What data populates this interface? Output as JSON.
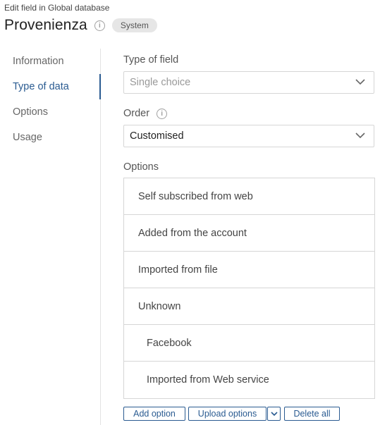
{
  "header": {
    "subtitle": "Edit field in Global database",
    "title": "Provenienza",
    "badge": "System"
  },
  "sidebar": {
    "items": [
      {
        "label": "Information"
      },
      {
        "label": "Type of data"
      },
      {
        "label": "Options"
      },
      {
        "label": "Usage"
      }
    ],
    "active": "Type of data"
  },
  "form": {
    "type_of_field": {
      "label": "Type of field",
      "value": "Single choice"
    },
    "order": {
      "label": "Order",
      "value": "Customised"
    },
    "options_label": "Options",
    "options": [
      {
        "label": "Self subscribed from web"
      },
      {
        "label": "Added from the account"
      },
      {
        "label": "Imported from file"
      },
      {
        "label": "Unknown"
      },
      {
        "label": "Facebook"
      },
      {
        "label": "Imported from Web service"
      }
    ]
  },
  "actions": {
    "add_option": "Add option",
    "upload_options": "Upload options",
    "delete_all": "Delete all"
  },
  "colors": {
    "accent": "#2a5b91",
    "border": "#d6d6d6",
    "badge_bg": "#e6e6e6"
  }
}
